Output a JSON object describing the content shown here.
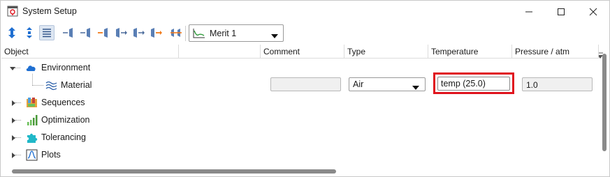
{
  "window": {
    "title": "System Setup",
    "icon": "system-setup-app-icon"
  },
  "toolbar": {
    "buttons": [
      {
        "name": "expand-vertical-icon"
      },
      {
        "name": "collapse-vertical-icon"
      },
      {
        "name": "list-view-icon"
      },
      {
        "name": "insert-surface-before-icon"
      },
      {
        "name": "insert-surface-after-icon"
      },
      {
        "name": "insert-surface-orange-icon"
      },
      {
        "name": "insert-surface-right-icon"
      },
      {
        "name": "move-surface-icon"
      },
      {
        "name": "move-surface-orange-icon"
      },
      {
        "name": "surface-group-icon"
      }
    ],
    "merit_select": {
      "value": "Merit 1",
      "icon": "chart-line-icon"
    }
  },
  "grid": {
    "columns": [
      "Object",
      "Comment",
      "Type",
      "Temperature",
      "Pressure / atm"
    ],
    "rows": {
      "environment": {
        "label": "Environment",
        "icon": "cloud-icon",
        "expanded": true
      },
      "material": {
        "label": "Material",
        "icon": "waves-icon",
        "comment": "",
        "type": "Air",
        "temperature": "temp (25.0)",
        "pressure": "1.0"
      },
      "sequences": {
        "label": "Sequences",
        "icon": "sequences-icon"
      },
      "optimization": {
        "label": "Optimization",
        "icon": "bar-chart-icon"
      },
      "tolerancing": {
        "label": "Tolerancing",
        "icon": "puzzle-icon"
      },
      "plots": {
        "label": "Plots",
        "icon": "plot-icon"
      }
    }
  },
  "colors": {
    "accent_blue": "#1f6fd1",
    "highlight_red": "#e0141e",
    "toolbar_orange": "#f07a1a"
  }
}
